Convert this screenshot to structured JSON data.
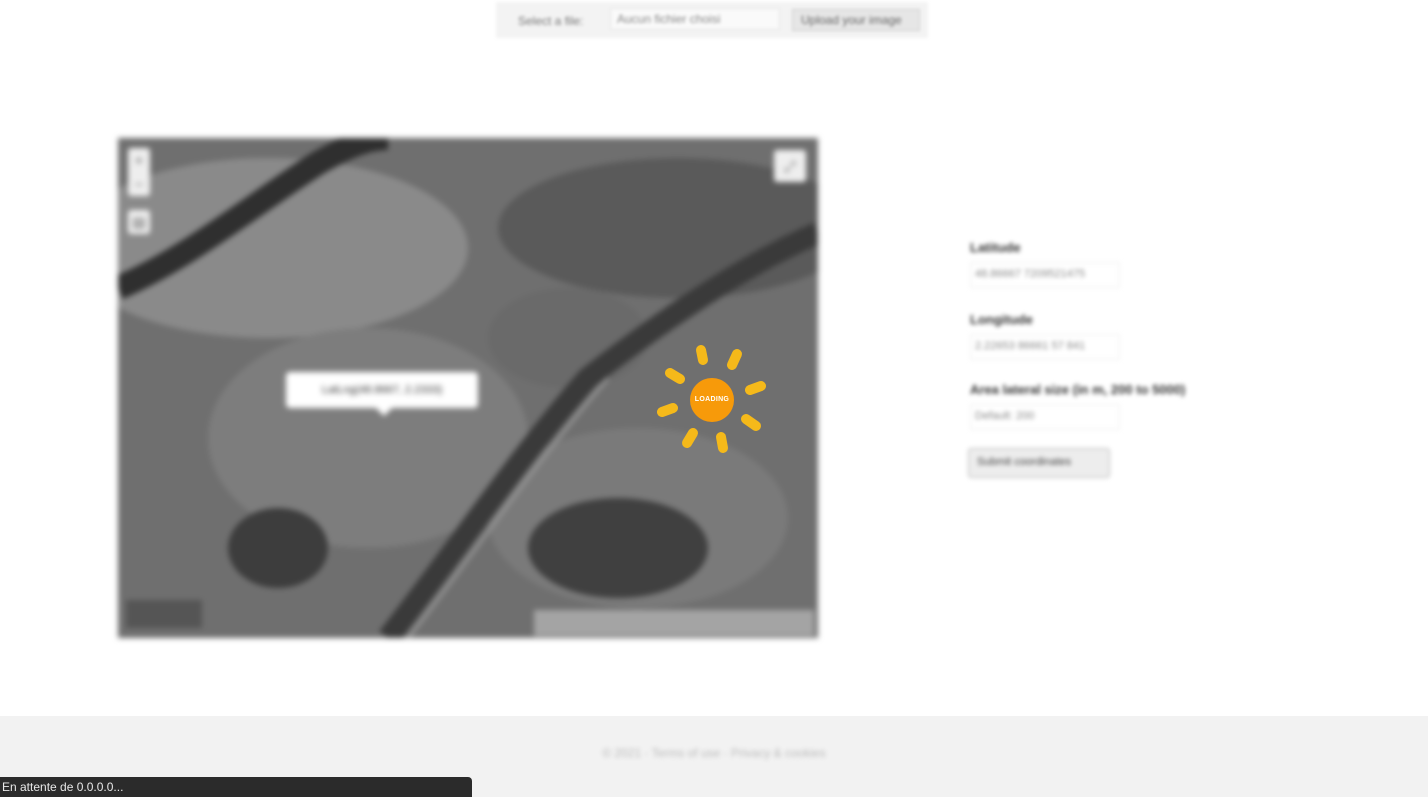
{
  "upload": {
    "label": "Select a file:",
    "file_value": "Aucun fichier choisi",
    "button_label": "Upload your image"
  },
  "map": {
    "zoom_in": "+",
    "zoom_out": "−",
    "layers_icon": "layers-icon",
    "fullscreen_icon": "fullscreen-icon",
    "logo_text": "",
    "attribution": "",
    "popup_text": "LatLng(48.8667, 2.2333)"
  },
  "loading": {
    "text": "LOADING",
    "color": "#f79a0a",
    "ray_color": "#f5b91a"
  },
  "form": {
    "latitude": {
      "label": "Latitude",
      "value": "48.86667 7209521475"
    },
    "longitude": {
      "label": "Longitude",
      "value": "2.22653 86661 57 841"
    },
    "area_size": {
      "label": "Area lateral size (in m, 200 to 5000)",
      "placeholder": "Default: 200"
    },
    "submit_label": "Submit coordinates"
  },
  "footer": {
    "text": "© 2021 · Terms of use · Privacy & cookies"
  },
  "status_bar": {
    "text": "En attente de 0.0.0.0..."
  }
}
